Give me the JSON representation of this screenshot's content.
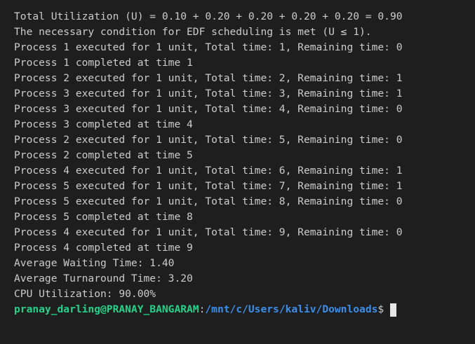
{
  "output_lines": [
    "Total Utilization (U) = 0.10 + 0.20 + 0.20 + 0.20 + 0.20 = 0.90",
    "The necessary condition for EDF scheduling is met (U ≤ 1).",
    "Process 1 executed for 1 unit, Total time: 1, Remaining time: 0",
    "Process 1 completed at time 1",
    "Process 2 executed for 1 unit, Total time: 2, Remaining time: 1",
    "Process 3 executed for 1 unit, Total time: 3, Remaining time: 1",
    "Process 3 executed for 1 unit, Total time: 4, Remaining time: 0",
    "Process 3 completed at time 4",
    "Process 2 executed for 1 unit, Total time: 5, Remaining time: 0",
    "Process 2 completed at time 5",
    "Process 4 executed for 1 unit, Total time: 6, Remaining time: 1",
    "Process 5 executed for 1 unit, Total time: 7, Remaining time: 1",
    "Process 5 executed for 1 unit, Total time: 8, Remaining time: 0",
    "Process 5 completed at time 8",
    "Process 4 executed for 1 unit, Total time: 9, Remaining time: 0",
    "Process 4 completed at time 9",
    "Average Waiting Time: 1.40",
    "Average Turnaround Time: 3.20",
    "CPU Utilization: 90.00%"
  ],
  "prompt": {
    "user_host": "pranay_darling@PRANAY_BANGARAM",
    "separator": ":",
    "path": "/mnt/c/Users/kaliv/Downloads",
    "symbol": "$"
  },
  "colors": {
    "background": "#1e1e1e",
    "text": "#cccccc",
    "user_host": "#23d18b",
    "path": "#3b8eea",
    "cursor": "#e6e6e6"
  }
}
